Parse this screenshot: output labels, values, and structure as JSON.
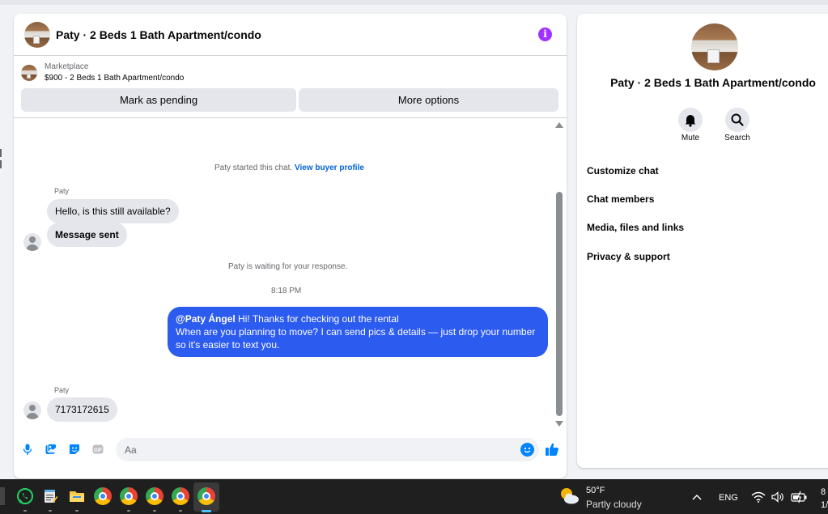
{
  "header": {
    "title": "Paty · 2 Beds 1 Bath Apartment/condo"
  },
  "marketplace": {
    "label": "Marketplace",
    "listing": "$900 - 2 Beds 1 Bath Apartment/condo"
  },
  "actions": {
    "mark_pending": "Mark as pending",
    "more_options": "More options"
  },
  "messages": {
    "started_prefix": "Paty started this chat.",
    "view_profile": "View buyer profile",
    "sender_1": "Paty",
    "msg_1": "Hello, is this still available?",
    "msg_2": "Message sent",
    "waiting": "Paty is waiting for your response.",
    "time": "8:18 PM",
    "out_mention": "@Paty Ángel",
    "out_line_1": " Hi! Thanks for checking out the rental",
    "out_line_2": "When are you planning to move? I can send pics & details — just drop your number so it's easier to text you.",
    "sender_2": "Paty",
    "msg_3": "7173172615"
  },
  "composer": {
    "placeholder": "Aa"
  },
  "panel": {
    "title": "Paty · 2 Beds 1 Bath Apartment/condo",
    "mute": "Mute",
    "search": "Search",
    "menu": [
      "Customize chat",
      "Chat members",
      "Media, files and links",
      "Privacy & support"
    ]
  },
  "taskbar": {
    "temp": "50°F",
    "weather": "Partly cloudy",
    "lang": "ENG",
    "clock_1": "8",
    "clock_2": "1/"
  },
  "colors": {
    "accent_blue": "#0064d1",
    "outgoing_bubble": "#2c5bf0",
    "info_purple": "#a033ff"
  }
}
